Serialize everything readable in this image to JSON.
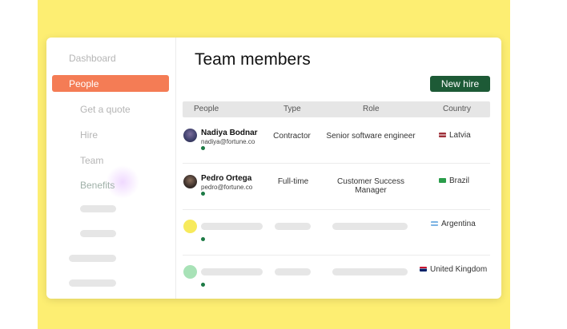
{
  "sidebar": {
    "items": [
      {
        "label": "Dashboard"
      },
      {
        "label": "People"
      },
      {
        "label": "Get a quote"
      },
      {
        "label": "Hire"
      },
      {
        "label": "Team"
      },
      {
        "label": "Benefits"
      }
    ]
  },
  "main": {
    "title": "Team members",
    "new_hire_label": "New hire",
    "columns": [
      "People",
      "Type",
      "Role",
      "Country"
    ],
    "rows": [
      {
        "name": "Nadiya Bodnar",
        "email": "nadiya@fortune.co",
        "type": "Contractor",
        "role": "Senior software engineer",
        "country": "Latvia"
      },
      {
        "name": "Pedro Ortega",
        "email": "pedro@fortune.co",
        "type": "Full-time",
        "role": "Customer Success Manager",
        "country": "Brazil"
      },
      {
        "country": "Argentina"
      },
      {
        "country": "United Kingdom"
      }
    ]
  },
  "colors": {
    "background": "#fdee72",
    "accent": "#f47c55",
    "primary_button": "#1d5a36",
    "status_dot": "#1d7a45",
    "placeholder_avatar_yellow": "#f7ea5c",
    "placeholder_avatar_green": "#a8e2b7"
  },
  "icons": {
    "latvia_flag": "latvia-flag-icon",
    "brazil_flag": "brazil-flag-icon",
    "argentina_flag": "argentina-flag-icon",
    "uk_flag": "uk-flag-icon"
  }
}
